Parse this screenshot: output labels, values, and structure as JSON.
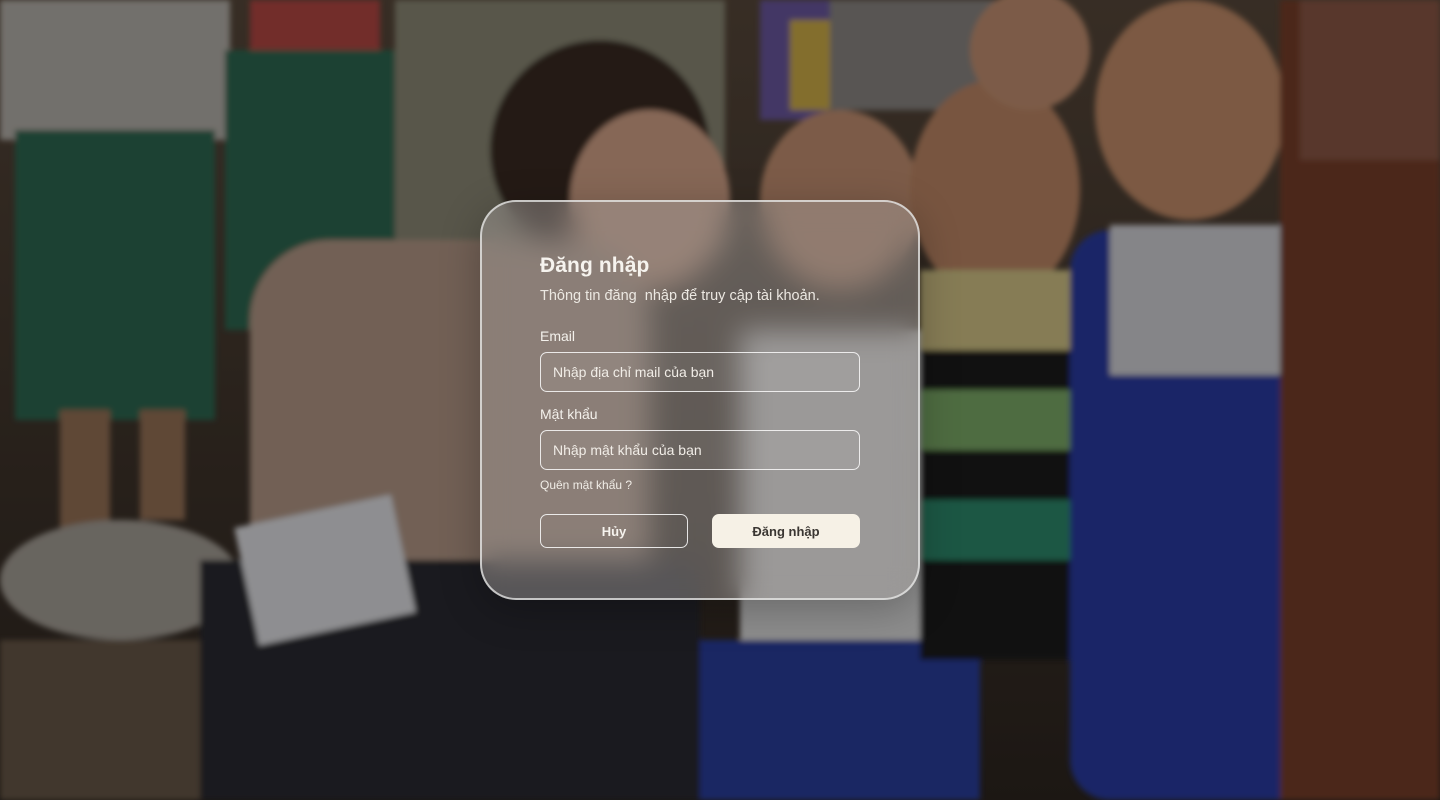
{
  "login": {
    "title": "Đăng nhập",
    "subtitle": "Thông tin đăng  nhập để truy cập tài khoản.",
    "email_label": "Email",
    "email_placeholder": "Nhập địa chỉ mail của bạn",
    "email_value": "",
    "password_label": "Mật khẩu",
    "password_placeholder": "Nhập mật khẩu của bạn",
    "password_value": "",
    "forgot_password": "Quên mật khẩu ?",
    "cancel_label": "Hủy",
    "submit_label": "Đăng nhập"
  },
  "colors": {
    "primary_button_bg": "#f6f1e6",
    "primary_button_text": "#3a3632",
    "card_border": "#ebebeb"
  }
}
